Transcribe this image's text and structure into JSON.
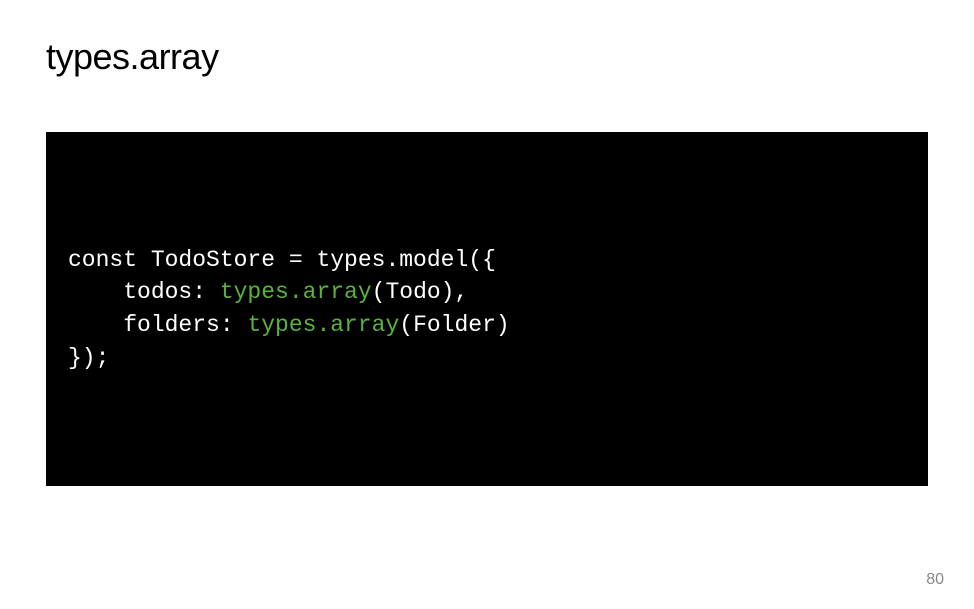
{
  "title": "types.array",
  "code": {
    "line1_a": "const TodoStore = types.model({",
    "line2_a": "    todos: ",
    "line2_hl": "types.array",
    "line2_b": "(Todo),",
    "line3_a": "    folders: ",
    "line3_hl": "types.array",
    "line3_b": "(Folder)",
    "line4_a": "});"
  },
  "pageNumber": "80"
}
